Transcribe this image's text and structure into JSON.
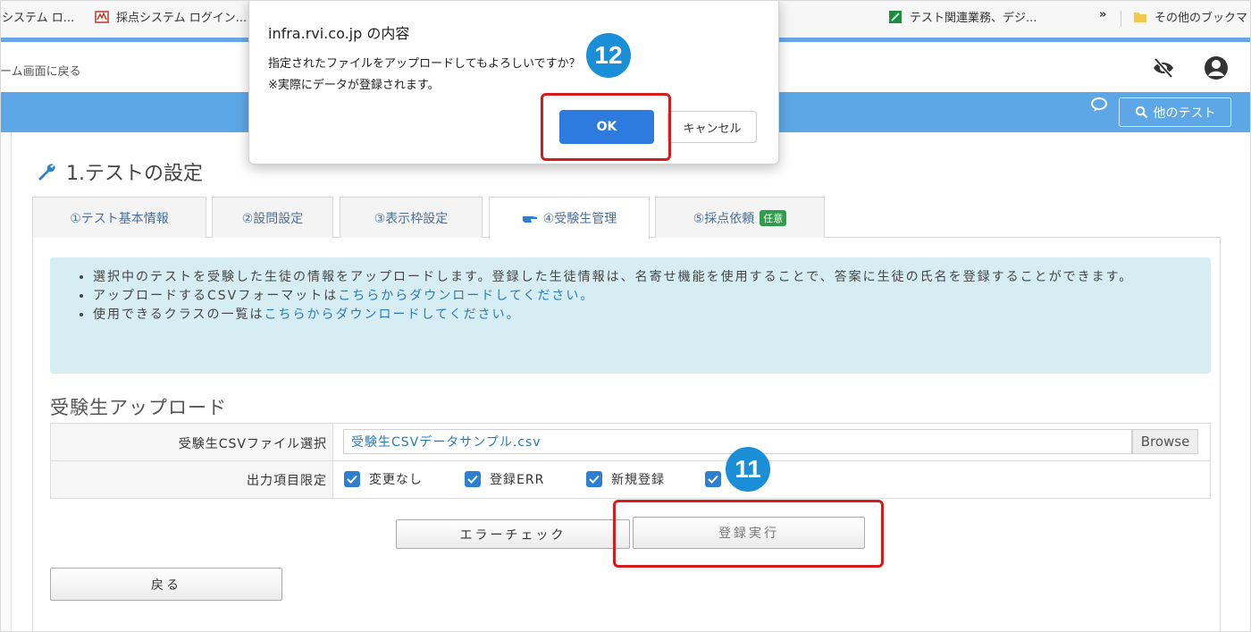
{
  "bookmarks": {
    "items": [
      {
        "label": "システム ロ...",
        "icon": "page-icon"
      },
      {
        "label": "採点システム ログイン...",
        "icon": "logo-icon"
      },
      {
        "label": "テスト関連業務、デジ...",
        "icon": "sheet-icon"
      },
      {
        "label": "»",
        "icon": "overflow-icon"
      },
      {
        "label": "その他のブックマ",
        "icon": "folder-icon"
      }
    ]
  },
  "header": {
    "back_home": "ーム画面に戻る",
    "search_other": "他のテスト"
  },
  "section": {
    "title": "1.テストの設定"
  },
  "tabs": [
    {
      "label": "①テスト基本情報"
    },
    {
      "label": "②設問設定"
    },
    {
      "label": "③表示枠設定"
    },
    {
      "label": "④受験生管理"
    },
    {
      "label": "⑤採点依頼",
      "badge": "任意"
    }
  ],
  "info": {
    "line1": "選択中のテストを受験した生徒の情報をアップロードします。登録した生徒情報は、名寄せ機能を使用することで、答案に生徒の氏名を登録することができます。",
    "line2_prefix": "アップロードするCSVフォーマットは",
    "line2_link": "こちらからダウンロードしてください。",
    "line3_prefix": "使用できるクラスの一覧は",
    "line3_link": "こちらからダウンロードしてください。"
  },
  "upload": {
    "title": "受験生アップロード",
    "file_label": "受験生CSVファイル選択",
    "file_value": "受験生CSVデータサンプル.csv",
    "browse": "Browse",
    "filter_label": "出力項目限定",
    "filters": [
      {
        "label": "変更なし",
        "checked": true
      },
      {
        "label": "登録ERR",
        "checked": true
      },
      {
        "label": "新規登録",
        "checked": true
      },
      {
        "label": "",
        "checked": true
      }
    ],
    "error_check": "エラーチェック",
    "register": "登録実行",
    "back": "戻る"
  },
  "dialog": {
    "title": "infra.rvi.co.jp の内容",
    "message1": "指定されたファイルをアップロードしてもよろしいですか？",
    "message2": "※実際にデータが登録されます。",
    "ok": "OK",
    "cancel": "キャンセル"
  },
  "annotations": {
    "step11": "11",
    "step12": "12"
  },
  "colors": {
    "accent_blue": "#5ea7e6",
    "highlight_red": "#d51c1c",
    "badge_blue": "#1a8fd8",
    "ok_blue": "#2e7be0",
    "info_bg": "#d6eef3"
  }
}
